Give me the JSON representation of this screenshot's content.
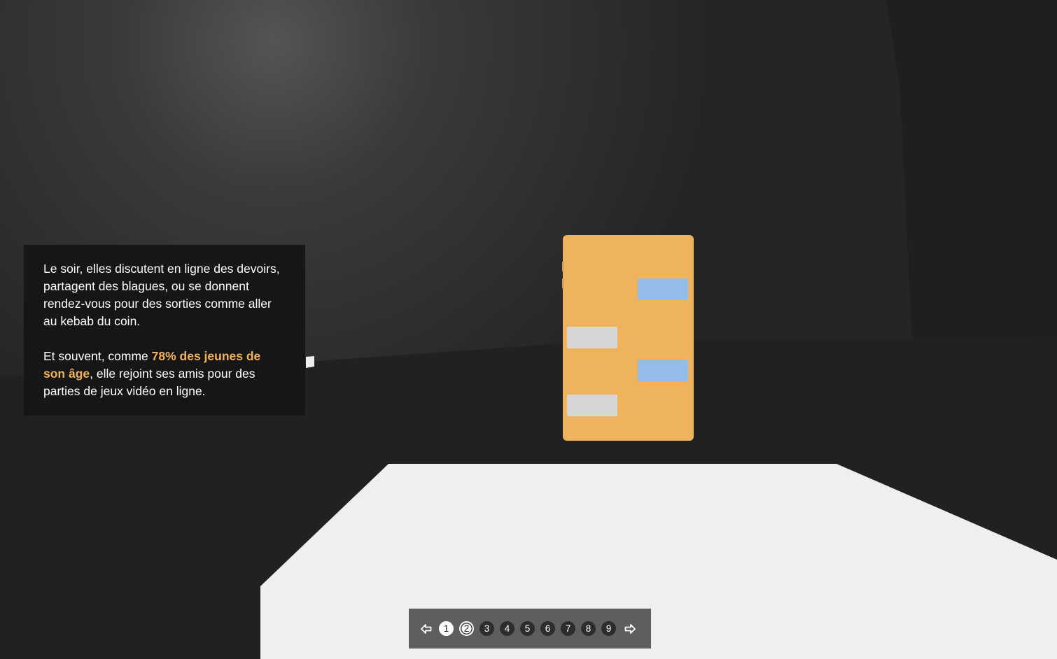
{
  "colors": {
    "background": "#242424",
    "panel_bg": "#161616",
    "highlight": "#f0b260",
    "phone": "#efb25d",
    "bubble_blue": "#93bde8",
    "bubble_gray": "#d8d5d8",
    "floor": "#efefef",
    "pager_bg": "#5e5e5e",
    "dot_active_bg": "#ffffff",
    "dot_inactive_bg": "#2c2c2c"
  },
  "story": {
    "paragraph_1": "Le soir, elles discutent en ligne des devoirs, partagent des blagues, ou se donnent rendez-vous pour des sorties comme aller au kebab du coin.",
    "paragraph_2_before": "Et souvent, comme ",
    "paragraph_2_highlight": "78% des jeunes de son âge",
    "paragraph_2_after": ", elle rejoint ses amis pour des parties de jeux vidéo en ligne."
  },
  "phone": {
    "messages": [
      {
        "side": "right",
        "color": "blue"
      },
      {
        "side": "left",
        "color": "gray"
      },
      {
        "side": "right",
        "color": "blue"
      },
      {
        "side": "left",
        "color": "gray"
      }
    ]
  },
  "pager": {
    "prev_icon": "arrow-left-icon",
    "next_icon": "arrow-right-icon",
    "pages": [
      "1",
      "2",
      "3",
      "4",
      "5",
      "6",
      "7",
      "8",
      "9"
    ],
    "current_page": "2",
    "visited_pages": [
      "1",
      "2"
    ]
  }
}
